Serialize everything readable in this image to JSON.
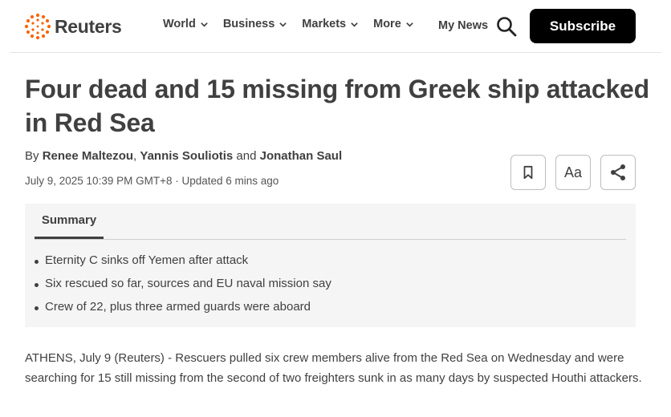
{
  "header": {
    "logo_text": "Reuters",
    "nav": [
      {
        "label": "World"
      },
      {
        "label": "Business"
      },
      {
        "label": "Markets"
      },
      {
        "label": "More"
      }
    ],
    "my_news": "My News",
    "subscribe": "Subscribe"
  },
  "article": {
    "headline": "Four dead and 15 missing from Greek ship attacked in Red Sea",
    "byline_prefix": "By",
    "authors": [
      "Renee Maltezou",
      "Yannis Souliotis",
      "Jonathan Saul"
    ],
    "byline_sep": ",",
    "byline_and": "and",
    "dateline": "July 9, 2025 10:39 PM GMT+8 · Updated 6 mins ago",
    "text_size_label": "Aa",
    "summary_tab": "Summary",
    "summary_items": [
      "Eternity C sinks off Yemen after attack",
      "Six rescued so far, sources and EU naval mission say",
      "Crew of 22, plus three armed guards were aboard"
    ],
    "lead": "ATHENS, July 9 (Reuters) - Rescuers pulled six crew members alive from the Red Sea on Wednesday and were searching for 15 still missing from the second of two freighters sunk in as many days by suspected Houthi attackers."
  },
  "colors": {
    "logo_accent": "#fa6400",
    "text": "#404040",
    "subscribe_bg": "#000000",
    "summary_bg": "#f5f5f5"
  },
  "icons": {
    "search": "search-icon",
    "bookmark": "bookmark-icon",
    "share": "share-icon",
    "chevron": "chevron-down-icon"
  }
}
